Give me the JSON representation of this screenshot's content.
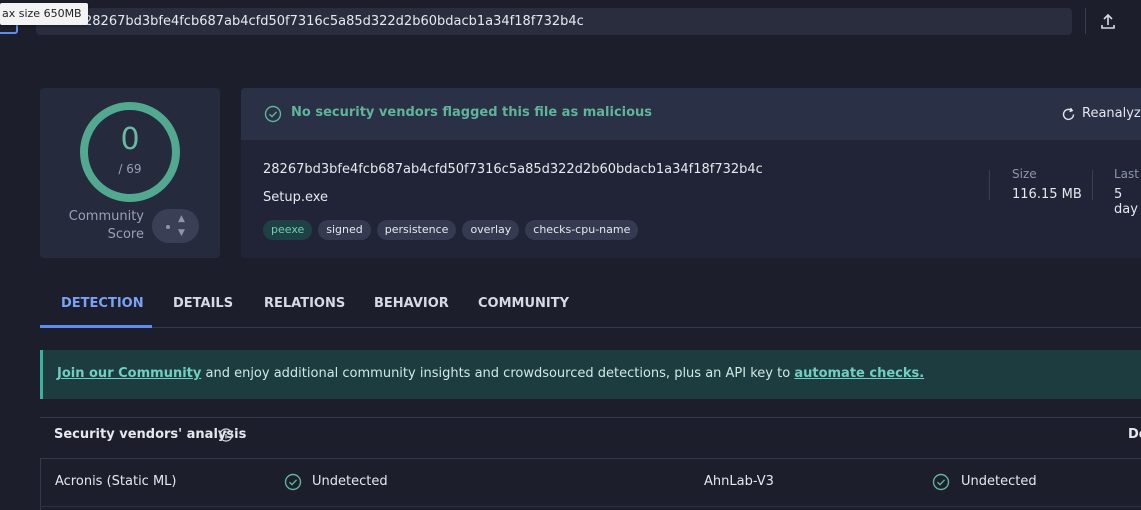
{
  "topbar": {
    "tooltip": "ax size 650MB",
    "search_value": "28267bd3bfe4fcb687ab4cfd50f7316c5a85d322d2b60bdacb1a34f18f732b4c"
  },
  "score": {
    "detections": "0",
    "total": "/ 69",
    "community_label_line1": "Community",
    "community_label_line2": "Score",
    "ring_color": "#52a98f"
  },
  "file": {
    "status": "No security vendors flagged this file as malicious",
    "reanalyze": "Reanalyze",
    "hash": "28267bd3bfe4fcb687ab4cfd50f7316c5a85d322d2b60bdacb1a34f18f732b4c",
    "name": "Setup.exe",
    "tags": [
      "peexe",
      "signed",
      "persistence",
      "overlay",
      "checks-cpu-name"
    ],
    "size_label": "Size",
    "size_value": "116.15 MB",
    "last_label": "Last",
    "last_value": "5 day"
  },
  "tabs": [
    "DETECTION",
    "DETAILS",
    "RELATIONS",
    "BEHAVIOR",
    "COMMUNITY"
  ],
  "banner": {
    "link1": "Join our Community",
    "middle": " and enjoy additional community insights and crowdsourced detections, plus an API key to ",
    "link2": "automate checks."
  },
  "vendors": {
    "header": "Security vendors' analysis",
    "right_header": "Do",
    "rows": [
      {
        "vendor1": "Acronis (Static ML)",
        "result1": "Undetected",
        "vendor2": "AhnLab-V3",
        "result2": "Undetected"
      }
    ]
  },
  "colors": {
    "background": "#1c1e2b",
    "accent_blue": "#5b8def",
    "success_green": "#5fb49a"
  }
}
